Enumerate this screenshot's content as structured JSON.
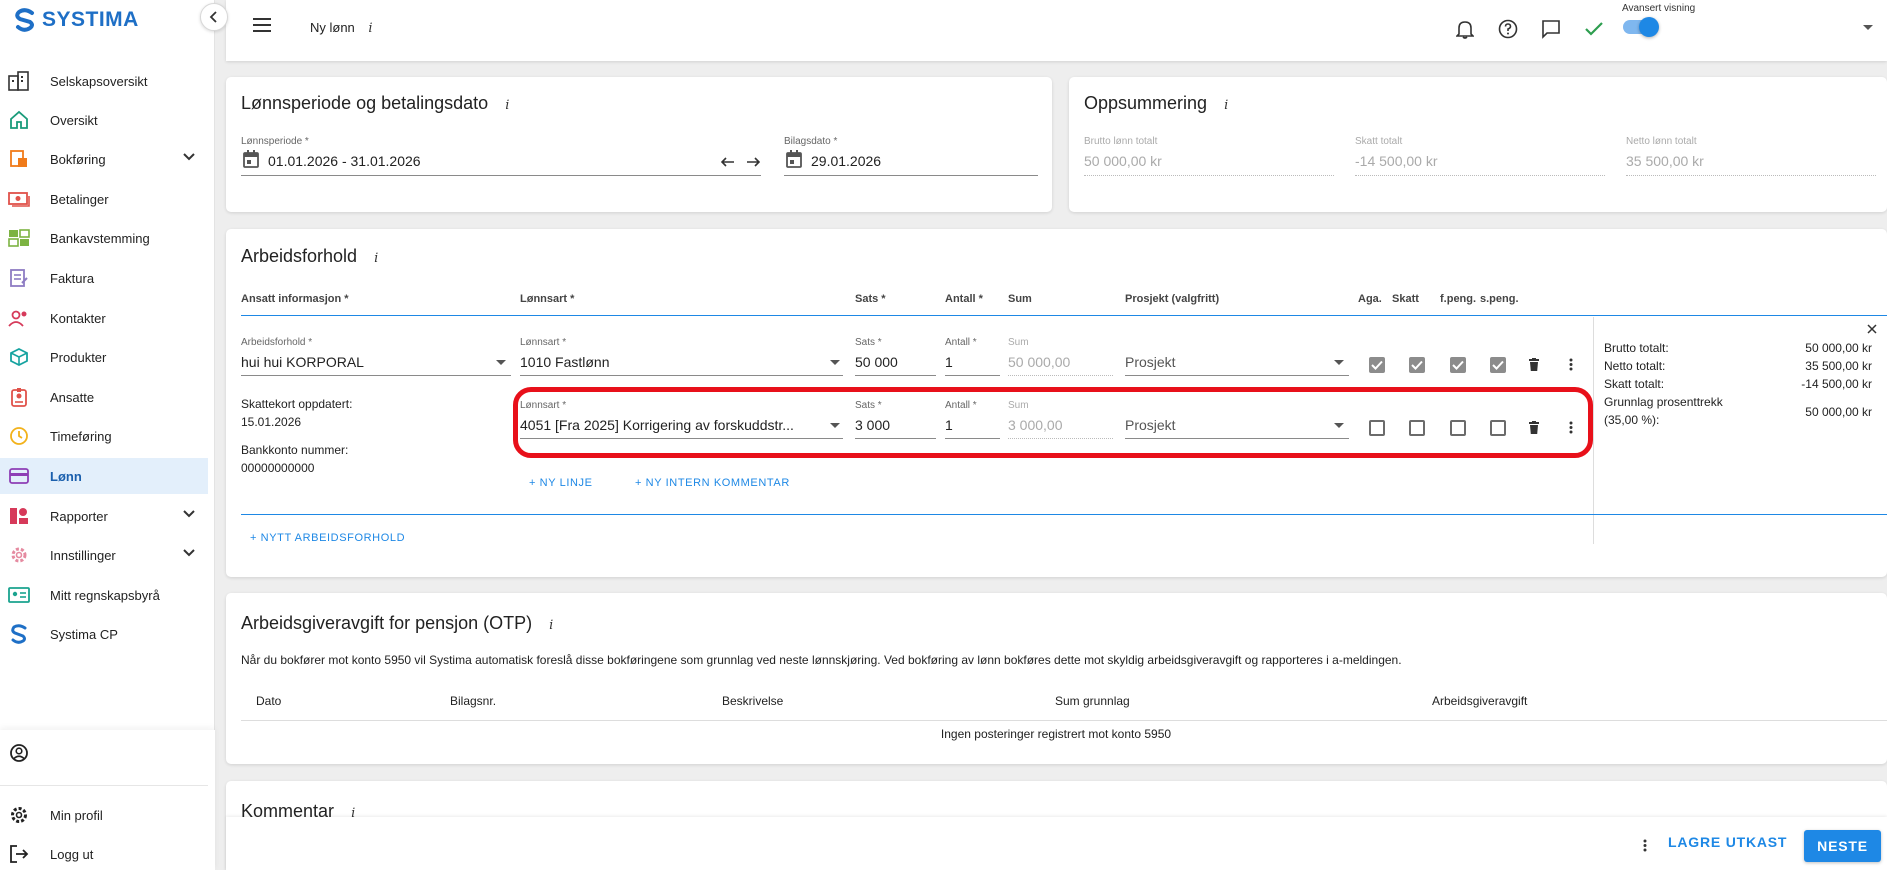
{
  "brand": {
    "name": "SYSTIMA"
  },
  "sidebar": {
    "items": [
      {
        "label": "Selskapsoversikt",
        "icon": "company-overview-icon"
      },
      {
        "label": "Oversikt",
        "icon": "home-icon"
      },
      {
        "label": "Bokføring",
        "icon": "accounting-icon"
      },
      {
        "label": "Betalinger",
        "icon": "payments-icon"
      },
      {
        "label": "Bankavstemming",
        "icon": "bank-reconciliation-icon"
      },
      {
        "label": "Faktura",
        "icon": "invoice-icon"
      },
      {
        "label": "Kontakter",
        "icon": "contacts-icon"
      },
      {
        "label": "Produkter",
        "icon": "products-icon"
      },
      {
        "label": "Ansatte",
        "icon": "employees-icon"
      },
      {
        "label": "Timeføring",
        "icon": "clock-icon"
      },
      {
        "label": "Lønn",
        "icon": "payroll-icon"
      },
      {
        "label": "Rapporter",
        "icon": "reports-icon"
      },
      {
        "label": "Innstillinger",
        "icon": "gear-icon"
      },
      {
        "label": "Mitt regnskapsbyrå",
        "icon": "accounting-firm-icon"
      },
      {
        "label": "Systima CP",
        "icon": "systima-cp-icon"
      }
    ],
    "bottom": [
      {
        "label": "",
        "icon": "user-circle-icon"
      },
      {
        "label": "Min profil",
        "icon": "settings-icon"
      },
      {
        "label": "Logg ut",
        "icon": "logout-icon"
      }
    ]
  },
  "header": {
    "title": "Ny lønn",
    "info": "i",
    "advanced_label": "Avansert visning"
  },
  "period_card": {
    "title": "Lønnsperiode og betalingsdato",
    "info": "i",
    "period_label": "Lønnsperiode *",
    "period_value": "01.01.2026 - 31.01.2026",
    "voucher_label": "Bilagsdato *",
    "voucher_value": "29.01.2026"
  },
  "summary_card": {
    "title": "Oppsummering",
    "info": "i",
    "gross_label": "Brutto lønn totalt",
    "gross_value": "50 000,00 kr",
    "tax_label": "Skatt totalt",
    "tax_value": "-14 500,00 kr",
    "net_label": "Netto lønn totalt",
    "net_value": "35 500,00 kr"
  },
  "employment": {
    "title": "Arbeidsforhold",
    "info": "i",
    "headers": {
      "employee": "Ansatt informasjon *",
      "wage_type": "Lønnsart *",
      "rate": "Sats *",
      "quantity": "Antall *",
      "sum": "Sum",
      "project": "Prosjekt (valgfritt)",
      "aga": "Aga.",
      "tax": "Skatt",
      "fpeng": "f.peng.",
      "speng": "s.peng."
    },
    "employment_label": "Arbeidsforhold *",
    "employment_value": "hui hui KORPORAL",
    "tax_card_label": "Skattekort oppdatert:",
    "tax_card_date": "15.01.2026",
    "bank_label": "Bankkonto nummer:",
    "bank_value": "00000000000",
    "lines": [
      {
        "wage_label": "Lønnsart *",
        "wage_value": "1010 Fastlønn",
        "rate_label": "Sats *",
        "rate_value": "50 000",
        "qty_label": "Antall *",
        "qty_value": "1",
        "sum_label": "Sum",
        "sum_value": "50 000,00",
        "project_value": "Prosjekt",
        "checks": [
          true,
          true,
          true,
          true
        ]
      },
      {
        "wage_label": "Lønnsart *",
        "wage_value": "4051 [Fra 2025] Korrigering av forskuddstr...",
        "rate_label": "Sats *",
        "rate_value": "3 000",
        "qty_label": "Antall *",
        "qty_value": "1",
        "sum_label": "Sum",
        "sum_value": "3 000,00",
        "project_value": "Prosjekt",
        "checks": [
          false,
          false,
          false,
          false
        ]
      }
    ],
    "new_line": "+ NY LINJE",
    "new_comment": "+ NY INTERN KOMMENTAR",
    "new_employment": "+ NYTT ARBEIDSFORHOLD",
    "totals": {
      "gross_label": "Brutto totalt:",
      "gross_value": "50 000,00 kr",
      "net_label": "Netto totalt:",
      "net_value": "35 500,00 kr",
      "tax_label": "Skatt totalt:",
      "tax_value": "-14 500,00 kr",
      "basis_label_1": "Grunnlag prosenttrekk",
      "basis_label_2": "(35,00 %):",
      "basis_value": "50 000,00 kr"
    }
  },
  "otp": {
    "title": "Arbeidsgiveravgift for pensjon (OTP)",
    "info": "i",
    "description": "Når du bokfører mot konto 5950 vil Systima automatisk foreslå disse bokføringene som grunnlag ved neste lønnskjøring. Ved bokføring av lønn bokføres dette mot skyldig arbeidsgiveravgift og rapporteres i a-meldingen.",
    "columns": [
      "Dato",
      "Bilagsnr.",
      "Beskrivelse",
      "Sum grunnlag",
      "Arbeidsgiveravgift"
    ],
    "empty": "Ingen posteringer registrert mot konto 5950"
  },
  "comment": {
    "title": "Kommentar",
    "info": "i"
  },
  "footer": {
    "save_draft": "LAGRE UTKAST",
    "next": "NESTE"
  },
  "colors": {
    "primary": "#1e88e5",
    "highlight": "#e8101a",
    "active_bg": "#e3effb"
  }
}
